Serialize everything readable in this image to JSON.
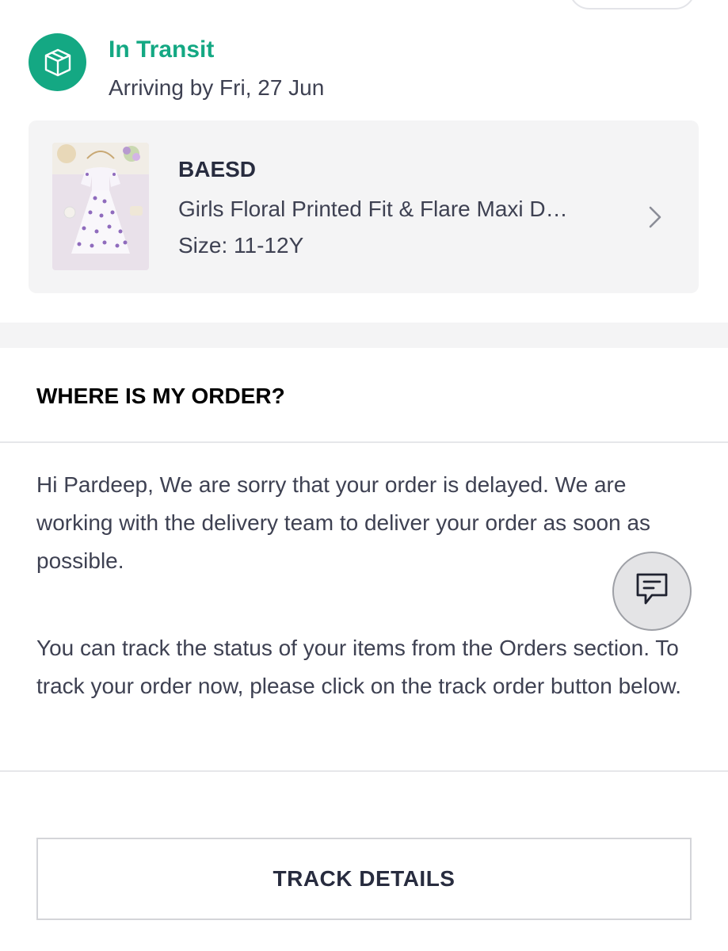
{
  "status": {
    "title": "In Transit",
    "subtitle": "Arriving by Fri, 27 Jun",
    "icon": "package-icon",
    "color": "#14a883"
  },
  "product": {
    "brand": "BAESD",
    "name": "Girls Floral Printed Fit & Flare Maxi D…",
    "size": "Size: 11-12Y",
    "thumbnail": "floral-dress-image",
    "chevron_icon": "chevron-right-icon"
  },
  "help": {
    "title": "WHERE IS MY ORDER?",
    "paragraph1": "Hi Pardeep, We are sorry that your order is delayed. We are working with the delivery team to deliver your order as soon as possible.",
    "paragraph2": "You can track the status of your items from the Orders section. To track your order now, please click on the track order button below."
  },
  "chat": {
    "icon": "chat-icon"
  },
  "actions": {
    "track_label": "TRACK DETAILS"
  }
}
